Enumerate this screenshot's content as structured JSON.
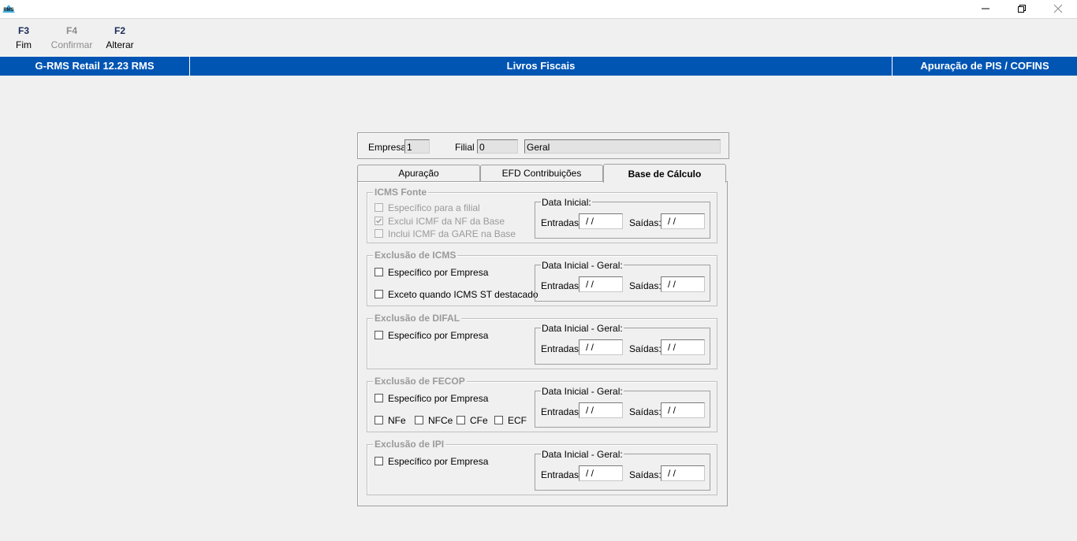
{
  "titlebar": {
    "logo_text": "RMS"
  },
  "toolbar": {
    "items": [
      {
        "key": "F3",
        "label": "Fim"
      },
      {
        "key": "F4",
        "label": "Confirmar"
      },
      {
        "key": "F2",
        "label": "Alterar"
      }
    ]
  },
  "header": {
    "left": "G-RMS Retail 12.23 RMS",
    "center": "Livros Fiscais",
    "right": "Apuração de PIS / COFINS"
  },
  "company": {
    "empresa_label": "Empresa",
    "empresa_value": "1",
    "filial_label": "Filial",
    "filial_value": "0",
    "filial_name": "Geral"
  },
  "tabs": [
    "Apuração",
    "EFD Contribuições",
    "Base de Cálculo"
  ],
  "groups": {
    "icms_fonte": {
      "title": "ICMS Fonte",
      "checks": [
        "Específico para a filial",
        "Exclui ICMF da NF da Base",
        "Inclui ICMF da GARE na Base"
      ],
      "date_title": "Data Inicial:",
      "entradas_label": "Entradas:",
      "entradas_value": "/ /",
      "saidas_label": "Saídas:",
      "saidas_value": "/ /"
    },
    "excl_icms": {
      "title": "Exclusão de ICMS",
      "checks": [
        "Específico por Empresa",
        "Exceto quando ICMS ST destacado"
      ],
      "date_title": "Data Inicial - Geral:",
      "entradas_label": "Entradas:",
      "entradas_value": "/ /",
      "saidas_label": "Saídas:",
      "saidas_value": "/ /"
    },
    "excl_difal": {
      "title": "Exclusão de DIFAL",
      "checks": [
        "Específico por Empresa"
      ],
      "date_title": "Data Inicial - Geral:",
      "entradas_label": "Entradas:",
      "entradas_value": "/ /",
      "saidas_label": "Saídas:",
      "saidas_value": "/ /"
    },
    "excl_fecop": {
      "title": "Exclusão de FECOP",
      "checks": [
        "Específico por Empresa"
      ],
      "types": [
        "NFe",
        "NFCe",
        "CFe",
        "ECF"
      ],
      "date_title": "Data Inicial - Geral:",
      "entradas_label": "Entradas:",
      "entradas_value": "/ /",
      "saidas_label": "Saídas:",
      "saidas_value": "/ /"
    },
    "excl_ipi": {
      "title": "Exclusão de IPI",
      "checks": [
        "Específico por Empresa"
      ],
      "date_title": "Data Inicial - Geral:",
      "entradas_label": "Entradas:",
      "entradas_value": "/ /",
      "saidas_label": "Saídas:",
      "saidas_value": "/ /"
    }
  },
  "colors": {
    "header_bg": "#0055b3",
    "disabled_text": "#9a9a9a"
  }
}
